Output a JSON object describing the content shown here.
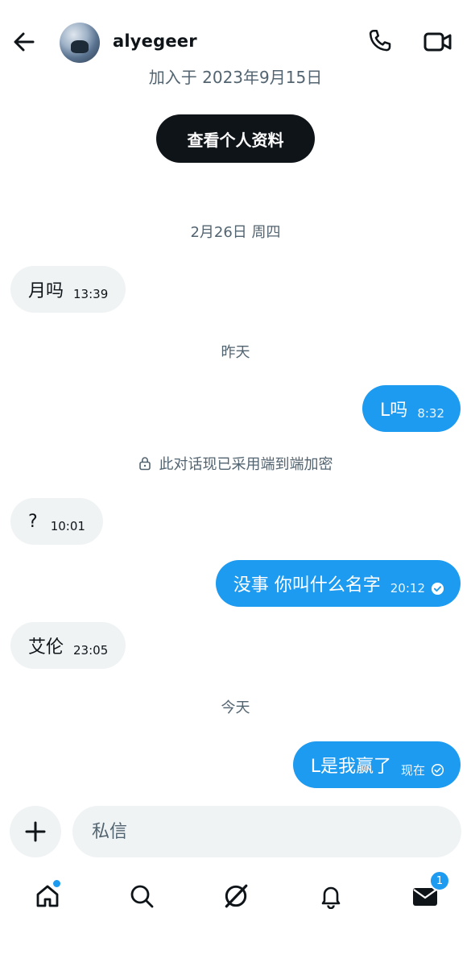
{
  "header": {
    "username": "alyegeer",
    "icons": {
      "back": "arrow-left-icon",
      "call": "phone-icon",
      "video": "video-camera-icon"
    }
  },
  "profile": {
    "joined": "加入于 2023年9月15日",
    "view_profile_label": "查看个人资料"
  },
  "separators": {
    "date1": "2月26日 周四",
    "yesterday": "昨天",
    "encryption": "此对话现已采用端到端加密",
    "today": "今天"
  },
  "messages": [
    {
      "side": "in",
      "text": "月吗",
      "time": "13:39"
    },
    {
      "side": "out",
      "text": "L吗",
      "time": "8:32"
    },
    {
      "side": "in",
      "text": "?",
      "time": "10:01"
    },
    {
      "side": "out",
      "text": "没事 你叫什么名字",
      "time": "20:12",
      "status": "read"
    },
    {
      "side": "in",
      "text": "艾伦",
      "time": "23:05"
    },
    {
      "side": "out",
      "text": "L是我赢了",
      "time": "现在",
      "status": "sent"
    }
  ],
  "composer": {
    "placeholder": "私信"
  },
  "tabbar": {
    "items": [
      "home-icon",
      "search-icon",
      "grok-icon",
      "bell-icon",
      "mail-icon"
    ],
    "mail_badge": "1"
  },
  "colors": {
    "accent": "#1d9bf0",
    "bubble_in": "#eff3f4",
    "text": "#0f1419",
    "muted": "#536471"
  }
}
